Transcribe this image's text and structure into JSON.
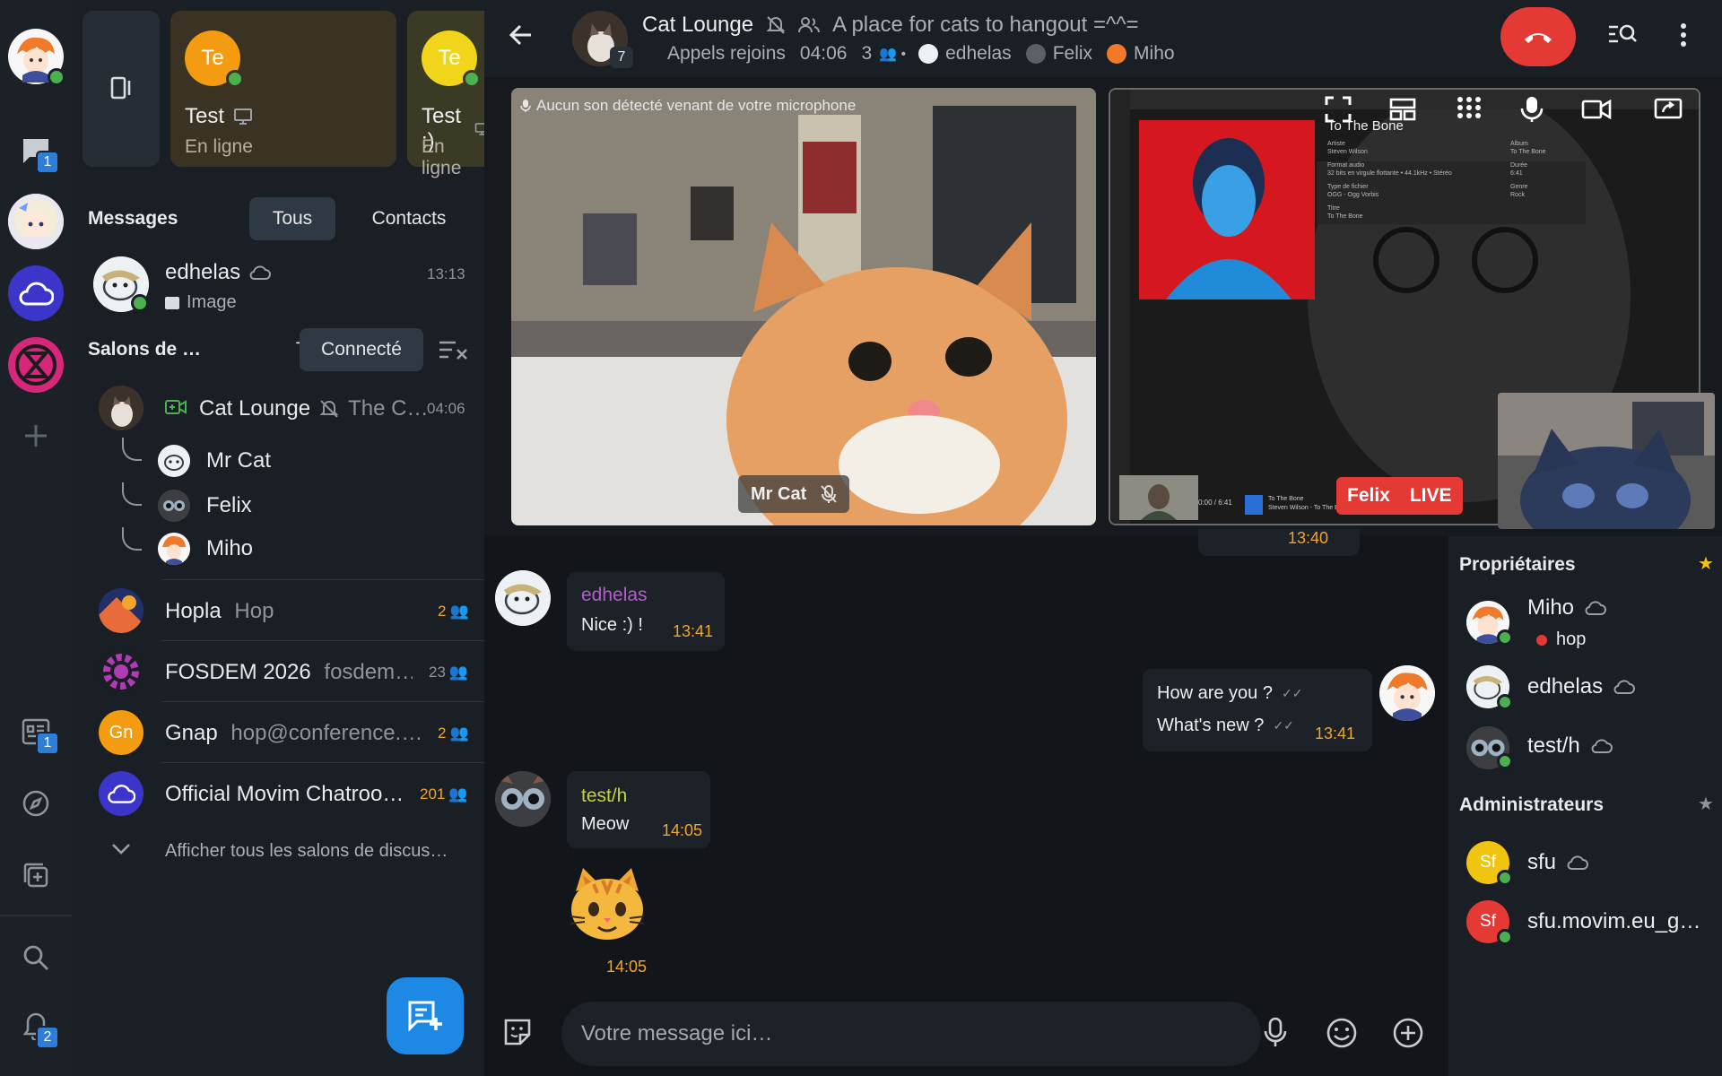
{
  "rail": {
    "chat_badge": "1",
    "news_badge": "1",
    "notif_badge": "2"
  },
  "sidebar": {
    "cards": [
      {
        "initials": "Te",
        "name": "Test",
        "status": "En ligne",
        "color": "#f39c12"
      },
      {
        "initials": "Te",
        "name": "Test :)",
        "status": "En ligne",
        "color": "#f1d51b"
      }
    ],
    "messages": {
      "title": "Messages",
      "filter_all": "Tous",
      "filter_contacts": "Contacts",
      "items": [
        {
          "name": "edhelas",
          "preview": "Image",
          "time": "13:13"
        }
      ]
    },
    "rooms": {
      "title": "Salons de …",
      "filter_all": "Tous",
      "filter_connected": "Connecté",
      "active": {
        "name": "Cat Lounge",
        "subject": "The C…",
        "time": "04:06",
        "participants": [
          "Mr Cat",
          "Felix",
          "Miho"
        ]
      },
      "items": [
        {
          "name": "Hopla",
          "subject": "Hop",
          "count": "2",
          "color": "#f2a52a"
        },
        {
          "name": "FOSDEM 2026",
          "subject": "fosdem…",
          "count": "23",
          "color": "#8d949b"
        },
        {
          "name": "Gnap",
          "subject": "hop@conference.…",
          "count": "2",
          "color": "#f2a52a",
          "initials": "Gn"
        },
        {
          "name": "Official Movim Chatroo…",
          "subject": "",
          "count": "201",
          "color": "#f2a52a"
        }
      ],
      "show_all": "Afficher tous les salons de discus…"
    }
  },
  "header": {
    "title": "Cat Lounge",
    "topic": "A place for cats to hangout =^^=",
    "avatar_badge": "7",
    "call_status": "Appels rejoins",
    "call_time": "04:06",
    "call_count": "3",
    "participants": [
      "edhelas",
      "Felix",
      "Miho"
    ]
  },
  "call": {
    "mic_warning": "Aucun son détecté venant de votre microphone",
    "video1_label": "Mr Cat",
    "video2_name": "Felix",
    "video2_live": "LIVE",
    "player": {
      "track": "To The Bone",
      "artist_label": "Artiste",
      "artist": "Steven Wilson",
      "album_label": "Album",
      "album": "To The Bone",
      "format_label": "Format audio",
      "format": "32 bits en virgule flottante • 44.1kHz • Stéréo",
      "duration_label": "Durée",
      "duration": "6:41",
      "filetype_label": "Type de fichier",
      "filetype": "OGG - Ogg Vorbis",
      "genre_label": "Genre",
      "genre": "Rock",
      "title_label": "Titre",
      "title": "To The Bone",
      "progress": "0:00 / 6:41",
      "now_playing": "To The Bone",
      "now_playing_artist": "Steven Wilson - To The Bone"
    }
  },
  "messages": [
    {
      "author": "edhelas",
      "text": "Nice :) !",
      "time": "13:41",
      "color": "#b65bd1"
    },
    {
      "lines": [
        "How are you ?",
        "What's new ?"
      ],
      "time": "13:41"
    },
    {
      "author": "test/h",
      "text": "Meow",
      "time": "14:05",
      "color": "#c8d334"
    },
    {
      "sticker": "cat-sticker",
      "time": "14:05"
    }
  ],
  "hidden_time": "13:40",
  "members": {
    "owners_title": "Propriétaires",
    "owners": [
      {
        "name": "Miho",
        "status": "hop"
      },
      {
        "name": "edhelas"
      },
      {
        "name": "test/h"
      }
    ],
    "admins_title": "Administrateurs",
    "admins": [
      {
        "name": "sfu",
        "initials": "Sf",
        "color": "#f1c40f"
      },
      {
        "name": "sfu.movim.eu_g…",
        "initials": "Sf",
        "color": "#e53935"
      }
    ]
  },
  "composer": {
    "placeholder": "Votre message ici…"
  },
  "colors": {
    "accent": "#1e88e5",
    "hangup": "#e53935",
    "time": "#f2a52a",
    "online": "#4caf50"
  }
}
